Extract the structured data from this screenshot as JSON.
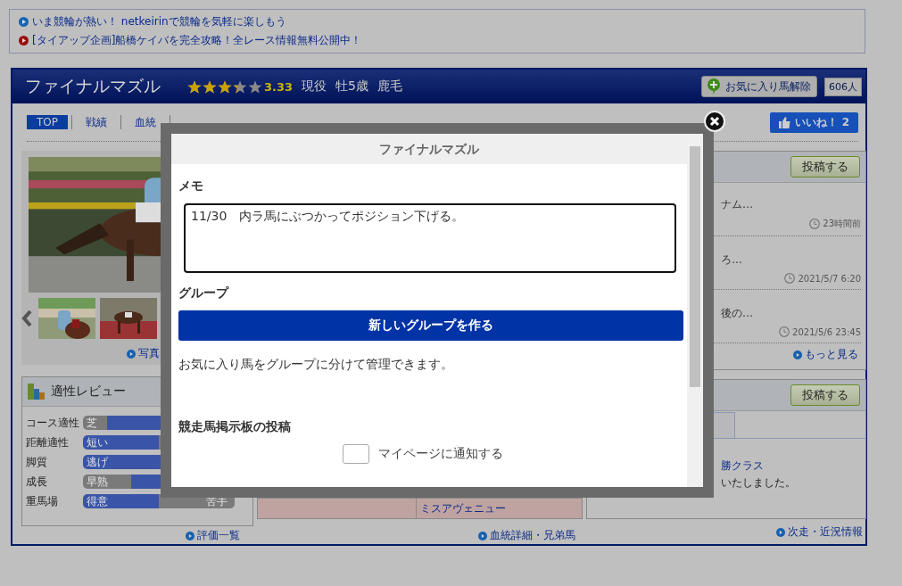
{
  "notices": [
    {
      "text": "いま競輪が熱い！ netkeirinで競輪を気軽に楽しもう",
      "color": "#1565b0"
    },
    {
      "text": "[タイアップ企画]船橋ケイバを完全攻略！全レース情報無料公開中！",
      "color": "#9a0f0f"
    }
  ],
  "horse": {
    "name": "ファイナルマズル",
    "stars": 3.33,
    "rating": "3.33",
    "status": "現役",
    "sex_age": "牡5歳",
    "coat": "鹿毛"
  },
  "favorite": {
    "label": "お気に入り馬解除",
    "count": "606人"
  },
  "nav": [
    {
      "label": "TOP",
      "selected": true
    },
    {
      "label": "戦績",
      "selected": false
    },
    {
      "label": "血統",
      "selected": false
    }
  ],
  "like_button": {
    "label": "いいね！",
    "count": "2"
  },
  "photo": {
    "link": "写真"
  },
  "review": {
    "title": "適性レビュー",
    "link": "評価一覧",
    "rows": [
      {
        "label": "コース適性",
        "left": "芝",
        "kind": "right",
        "level": 0.16
      },
      {
        "label": "距離適性",
        "left": "短い",
        "kind": "left",
        "level": 0.5
      },
      {
        "label": "脚質",
        "left": "逃げ",
        "kind": "left",
        "level": 0.55
      },
      {
        "label": "成長",
        "left": "早熟",
        "kind": "right",
        "level": 0.32
      },
      {
        "label": "重馬場",
        "left": "得意",
        "right": "苦手",
        "kind": "left",
        "level": 0.5
      }
    ]
  },
  "pedigree": {
    "cells": [
      "",
      "ミスアヴェニュー"
    ],
    "link": "血統詳細・兄弟馬"
  },
  "board": {
    "post_button": "投稿する",
    "more_link": "もっと見る",
    "posts": [
      {
        "text": "ナム…",
        "time": "23時間前"
      },
      {
        "text": "ろ…",
        "time": "2021/5/7 6:20"
      },
      {
        "text": "後の…",
        "time": "2021/5/6 23:45"
      }
    ]
  },
  "news": {
    "post_button": "投稿する",
    "link_text": "勝クラス",
    "text": "いたしました。",
    "more_link": "次走・近況情報"
  },
  "modal": {
    "title": "ファイナルマズル",
    "memo_label": "メモ",
    "memo_value": "11/30　内ラ馬にぶつかってポジション下げる。",
    "group_label": "グループ",
    "group_button": "新しいグループを作る",
    "group_note": "お気に入り馬をグループに分けて管理できます。",
    "board_label": "競走馬掲示板の投稿",
    "notify": {
      "label": "マイページに通知する",
      "checked": false
    }
  }
}
